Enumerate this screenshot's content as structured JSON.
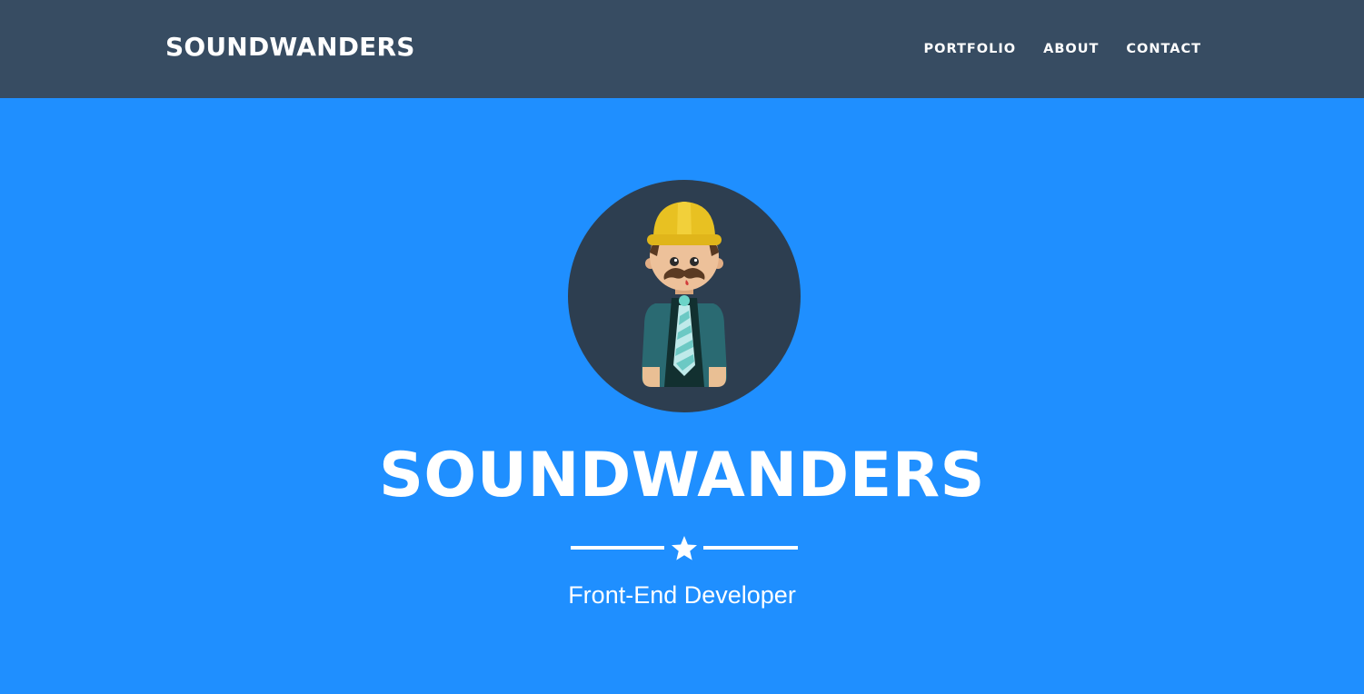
{
  "navbar": {
    "brand": "SOUNDWANDERS",
    "links": [
      {
        "label": "PORTFOLIO"
      },
      {
        "label": "ABOUT"
      },
      {
        "label": "CONTACT"
      }
    ]
  },
  "hero": {
    "avatar_icon": "developer-avatar-icon",
    "title": "SOUNDWANDERS",
    "divider_icon": "star-icon",
    "subtitle": "Front-End Developer"
  },
  "colors": {
    "navbar_bg": "#374c62",
    "hero_bg": "#1f8fff",
    "text": "#ffffff",
    "avatar_circle": "#2d3e50",
    "helmet": "#e8c122"
  }
}
